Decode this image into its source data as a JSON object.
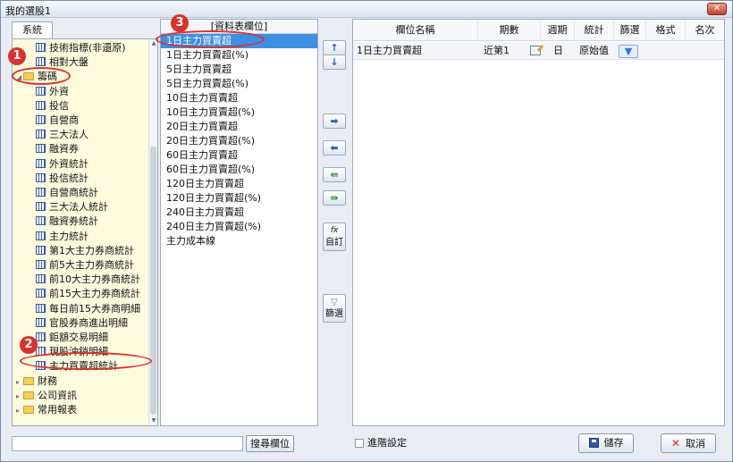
{
  "window": {
    "title": "我的選股1",
    "close_label": "✕"
  },
  "left": {
    "tab": "系統",
    "items": [
      {
        "label": "技術指標(非還原)",
        "type": "table"
      },
      {
        "label": "相對大盤",
        "type": "table"
      },
      {
        "label": "籌碼",
        "type": "folder",
        "open": true
      },
      {
        "label": "外資",
        "type": "table"
      },
      {
        "label": "投信",
        "type": "table"
      },
      {
        "label": "自營商",
        "type": "table"
      },
      {
        "label": "三大法人",
        "type": "table"
      },
      {
        "label": "融資券",
        "type": "table"
      },
      {
        "label": "外資統計",
        "type": "table"
      },
      {
        "label": "投信統計",
        "type": "table"
      },
      {
        "label": "自營商統計",
        "type": "table"
      },
      {
        "label": "三大法人統計",
        "type": "table"
      },
      {
        "label": "融資券統計",
        "type": "table"
      },
      {
        "label": "主力統計",
        "type": "table"
      },
      {
        "label": "第1大主力券商統計",
        "type": "table"
      },
      {
        "label": "前5大主力券商統計",
        "type": "table"
      },
      {
        "label": "前10大主力券商統計",
        "type": "table"
      },
      {
        "label": "前15大主力券商統計",
        "type": "table"
      },
      {
        "label": "每日前15大券商明細",
        "type": "table"
      },
      {
        "label": "官股券商進出明細",
        "type": "table"
      },
      {
        "label": "鉅額交易明細",
        "type": "table"
      },
      {
        "label": "現股沖銷明細",
        "type": "table"
      },
      {
        "label": "主力買賣超統計",
        "type": "table"
      },
      {
        "label": "財務",
        "type": "folder",
        "open": false
      },
      {
        "label": "公司資訊",
        "type": "folder",
        "open": false
      },
      {
        "label": "常用報表",
        "type": "folder",
        "open": false
      }
    ]
  },
  "middle": {
    "header": "[資料表欄位]",
    "items": [
      "1日主力買賣超",
      "1日主力買賣超(%)",
      "5日主力買賣超",
      "5日主力買賣超(%)",
      "10日主力買賣超",
      "10日主力買賣超(%)",
      "20日主力買賣超",
      "20日主力買賣超(%)",
      "60日主力買賣超",
      "60日主力買賣超(%)",
      "120日主力買賣超",
      "120日主力買賣超(%)",
      "240日主力買賣超",
      "240日主力買賣超(%)",
      "主力成本線"
    ],
    "selected_index": 0
  },
  "buttons": {
    "up": "↑",
    "down": "↓",
    "add": "➡",
    "remove": "⬅",
    "remove_all": "⇚",
    "add_all": "⇛",
    "custom_icon": "fx",
    "custom": "自訂",
    "filter_icon": "▽",
    "filter": "篩選"
  },
  "grid": {
    "headers": [
      "欄位名稱",
      "期數",
      "週期",
      "統計",
      "篩選",
      "格式",
      "名次"
    ],
    "rows": [
      {
        "name": "1日主力買賣超",
        "period": "近第1",
        "cycle": "日",
        "stat": "原始值",
        "filter_icon": "▼"
      }
    ]
  },
  "bottom": {
    "search_placeholder": "",
    "search_button": "搜尋欄位",
    "advanced": "進階設定",
    "save": "儲存",
    "cancel": "取消"
  },
  "annotations": [
    "1",
    "2",
    "3"
  ],
  "colors": {
    "selection": "#3e8ee3",
    "tree_bg": "#fefbdf",
    "annotation": "#d8322c"
  }
}
